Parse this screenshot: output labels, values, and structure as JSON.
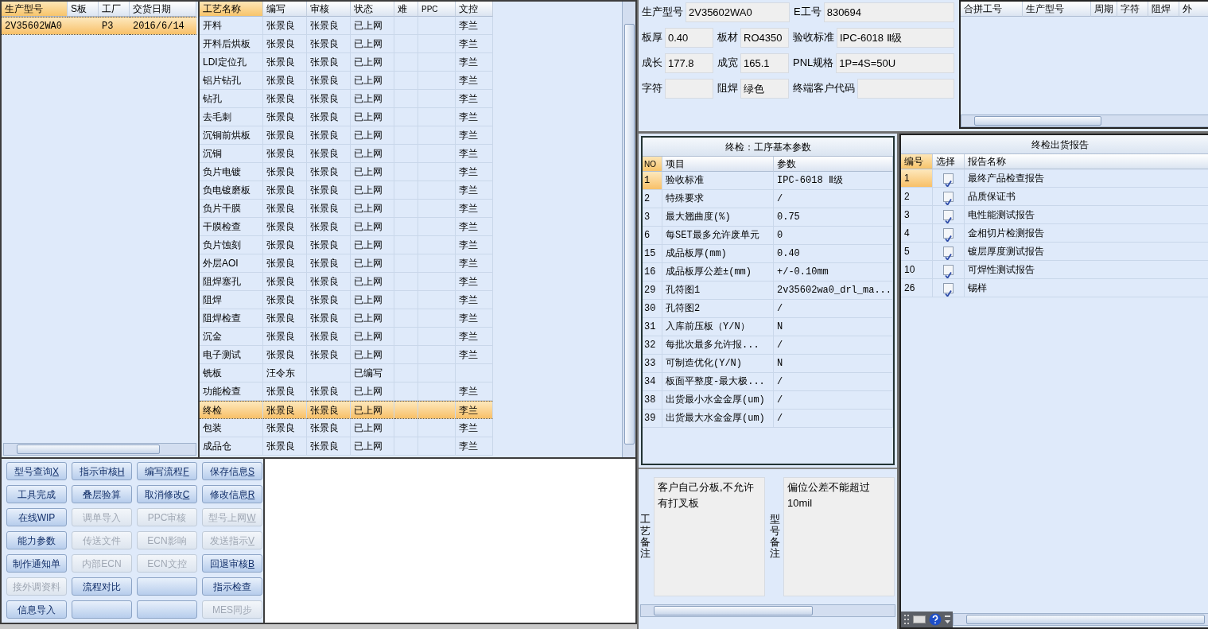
{
  "orders": {
    "columns": [
      "生产型号",
      "S板",
      "工厂",
      "交货日期"
    ],
    "rows": [
      {
        "model": "2V35602WA0",
        "factory": "P3",
        "date": "2016/6/14",
        "selected": true
      }
    ]
  },
  "processes": {
    "columns": [
      "工艺名称",
      "编写",
      "审核",
      "状态",
      "难",
      "PPC",
      "文控"
    ],
    "rows": [
      {
        "name": "开料",
        "writer": "张景良",
        "reviewer": "张景良",
        "status": "已上网",
        "doc_control": "李兰",
        "selected": false
      },
      {
        "name": "开料后烘板",
        "writer": "张景良",
        "reviewer": "张景良",
        "status": "已上网",
        "doc_control": "李兰",
        "selected": false
      },
      {
        "name": "LDI定位孔",
        "writer": "张景良",
        "reviewer": "张景良",
        "status": "已上网",
        "doc_control": "李兰",
        "selected": false
      },
      {
        "name": "铝片钻孔",
        "writer": "张景良",
        "reviewer": "张景良",
        "status": "已上网",
        "doc_control": "李兰",
        "selected": false
      },
      {
        "name": "钻孔",
        "writer": "张景良",
        "reviewer": "张景良",
        "status": "已上网",
        "doc_control": "李兰",
        "selected": false
      },
      {
        "name": "去毛刺",
        "writer": "张景良",
        "reviewer": "张景良",
        "status": "已上网",
        "doc_control": "李兰",
        "selected": false
      },
      {
        "name": "沉铜前烘板",
        "writer": "张景良",
        "reviewer": "张景良",
        "status": "已上网",
        "doc_control": "李兰",
        "selected": false
      },
      {
        "name": "沉铜",
        "writer": "张景良",
        "reviewer": "张景良",
        "status": "已上网",
        "doc_control": "李兰",
        "selected": false
      },
      {
        "name": "负片电镀",
        "writer": "张景良",
        "reviewer": "张景良",
        "status": "已上网",
        "doc_control": "李兰",
        "selected": false
      },
      {
        "name": "负电镀磨板",
        "writer": "张景良",
        "reviewer": "张景良",
        "status": "已上网",
        "doc_control": "李兰",
        "selected": false
      },
      {
        "name": "负片干膜",
        "writer": "张景良",
        "reviewer": "张景良",
        "status": "已上网",
        "doc_control": "李兰",
        "selected": false
      },
      {
        "name": "干膜检查",
        "writer": "张景良",
        "reviewer": "张景良",
        "status": "已上网",
        "doc_control": "李兰",
        "selected": false
      },
      {
        "name": "负片蚀刻",
        "writer": "张景良",
        "reviewer": "张景良",
        "status": "已上网",
        "doc_control": "李兰",
        "selected": false
      },
      {
        "name": "外层AOI",
        "writer": "张景良",
        "reviewer": "张景良",
        "status": "已上网",
        "doc_control": "李兰",
        "selected": false
      },
      {
        "name": "阻焊塞孔",
        "writer": "张景良",
        "reviewer": "张景良",
        "status": "已上网",
        "doc_control": "李兰",
        "selected": false
      },
      {
        "name": "阻焊",
        "writer": "张景良",
        "reviewer": "张景良",
        "status": "已上网",
        "doc_control": "李兰",
        "selected": false
      },
      {
        "name": "阻焊检查",
        "writer": "张景良",
        "reviewer": "张景良",
        "status": "已上网",
        "doc_control": "李兰",
        "selected": false
      },
      {
        "name": "沉金",
        "writer": "张景良",
        "reviewer": "张景良",
        "status": "已上网",
        "doc_control": "李兰",
        "selected": false
      },
      {
        "name": "电子测试",
        "writer": "张景良",
        "reviewer": "张景良",
        "status": "已上网",
        "doc_control": "李兰",
        "selected": false
      },
      {
        "name": "铣板",
        "writer": "汪令东",
        "status": "已编写",
        "selected": false
      },
      {
        "name": "功能检查",
        "writer": "张景良",
        "reviewer": "张景良",
        "status": "已上网",
        "doc_control": "李兰",
        "selected": false
      },
      {
        "name": "终检",
        "writer": "张景良",
        "reviewer": "张景良",
        "status": "已上网",
        "doc_control": "李兰",
        "selected": true
      },
      {
        "name": "包装",
        "writer": "张景良",
        "reviewer": "张景良",
        "status": "已上网",
        "doc_control": "李兰",
        "selected": false
      },
      {
        "name": "成品仓",
        "writer": "张景良",
        "reviewer": "张景良",
        "status": "已上网",
        "doc_control": "李兰",
        "selected": false
      }
    ]
  },
  "buttons": [
    {
      "label": "型号查询",
      "hotkey": "X",
      "disabled": false
    },
    {
      "label": "指示审核",
      "hotkey": "H",
      "disabled": false
    },
    {
      "label": "编写流程",
      "hotkey": "F",
      "disabled": false
    },
    {
      "label": "保存信息",
      "hotkey": "S",
      "disabled": false
    },
    {
      "label": "工具完成",
      "disabled": false
    },
    {
      "label": "叠层验算",
      "disabled": false
    },
    {
      "label": "取消修改",
      "hotkey": "C",
      "disabled": false
    },
    {
      "label": "修改信息",
      "hotkey": "R",
      "disabled": false
    },
    {
      "label": "在线WIP",
      "disabled": false
    },
    {
      "label": "调单导入",
      "disabled": true
    },
    {
      "label": "PPC审核",
      "disabled": true
    },
    {
      "label": "型号上网",
      "hotkey": "W",
      "disabled": true
    },
    {
      "label": "能力参数",
      "disabled": false
    },
    {
      "label": "传送文件",
      "disabled": true
    },
    {
      "label": "ECN影响",
      "disabled": true
    },
    {
      "label": "发送指示",
      "hotkey": "V",
      "disabled": true
    },
    {
      "label": "制作通知单",
      "disabled": false
    },
    {
      "label": "内部ECN",
      "disabled": true
    },
    {
      "label": "ECN文控",
      "disabled": true
    },
    {
      "label": "回退审核",
      "hotkey": "B",
      "disabled": false
    },
    {
      "label": "接外调资料",
      "disabled": true
    },
    {
      "label": "流程对比",
      "disabled": false
    },
    {
      "disabled": false
    },
    {
      "label": "指示检查",
      "disabled": false
    },
    {
      "label": "信息导入",
      "disabled": false
    },
    {
      "disabled": false
    },
    {
      "disabled": false
    },
    {
      "label": "MES同步",
      "disabled": true
    }
  ],
  "info": {
    "fields": [
      {
        "label": "生产型号",
        "value": "2V35602WA0"
      },
      {
        "label": "E工号",
        "value": "830694"
      },
      {
        "label": "板厚",
        "value": "0.40"
      },
      {
        "label": "板材",
        "value": "RO4350"
      },
      {
        "label": "验收标准",
        "value": "IPC-6018 Ⅱ级"
      },
      {
        "label": "成长",
        "value": "177.8"
      },
      {
        "label": "成宽",
        "value": "165.1"
      },
      {
        "label": "PNL规格",
        "value": "1P=4S=50U"
      },
      {
        "label": "字符"
      },
      {
        "label": "阻焊",
        "value": "绿色"
      },
      {
        "label": "终端客户代码"
      }
    ]
  },
  "merged": {
    "columns": [
      "合拼工号",
      "生产型号",
      "周期",
      "字符",
      "阻焊",
      "外"
    ]
  },
  "params": {
    "title": "终检：工序基本参数",
    "columns": [
      "NO",
      "项目",
      "参数"
    ],
    "rows": [
      {
        "no": "1",
        "item": "验收标准",
        "value": "IPC-6018 Ⅱ级",
        "selected": true
      },
      {
        "no": "2",
        "item": "特殊要求",
        "value": "/",
        "selected": false
      },
      {
        "no": "3",
        "item": "最大翘曲度(%)",
        "value": "0.75",
        "selected": false
      },
      {
        "no": "6",
        "item": "每SET最多允许废单元",
        "value": "0",
        "selected": false
      },
      {
        "no": "15",
        "item": "成品板厚(mm)",
        "value": "0.40",
        "selected": false
      },
      {
        "no": "16",
        "item": "成品板厚公差±(mm)",
        "value": "+/-0.10mm",
        "selected": false
      },
      {
        "no": "29",
        "item": "孔符图1",
        "value": "2v35602wa0_drl_ma...",
        "selected": false
      },
      {
        "no": "30",
        "item": "孔符图2",
        "value": "/",
        "selected": false
      },
      {
        "no": "31",
        "item": "入库前压板（Y/N）",
        "value": "N",
        "selected": false
      },
      {
        "no": "32",
        "item": "每批次最多允许报...",
        "value": "/",
        "selected": false
      },
      {
        "no": "33",
        "item": "可制造优化(Y/N)",
        "value": "N",
        "selected": false
      },
      {
        "no": "34",
        "item": "板面平整度-最大极...",
        "value": "/",
        "selected": false
      },
      {
        "no": "38",
        "item": "出货最小水金金厚(um)",
        "value": "/",
        "selected": false
      },
      {
        "no": "39",
        "item": "出货最大水金金厚(um)",
        "value": "/",
        "selected": false
      }
    ]
  },
  "notes": [
    {
      "label": "工艺备注",
      "text": "客户自己分板,不允许有打叉板"
    },
    {
      "label": "型号备注",
      "text": "偏位公差不能超过10mil"
    }
  ],
  "reports": {
    "title": "终检出货报告",
    "columns": [
      "编号",
      "选择",
      "报告名称"
    ],
    "rows": [
      {
        "no": "1",
        "checked": true,
        "name": "最终产品检查报告",
        "selected": true
      },
      {
        "no": "2",
        "checked": true,
        "name": "品质保证书",
        "selected": false
      },
      {
        "no": "3",
        "checked": true,
        "name": "电性能测试报告",
        "selected": false
      },
      {
        "no": "4",
        "checked": true,
        "name": "金相切片检测报告",
        "selected": false
      },
      {
        "no": "5",
        "checked": true,
        "name": "镀层厚度测试报告",
        "selected": false
      },
      {
        "no": "10",
        "checked": true,
        "name": "可焊性测试报告",
        "selected": false
      },
      {
        "no": "26",
        "checked": true,
        "name": "锡样",
        "selected": false
      }
    ]
  }
}
